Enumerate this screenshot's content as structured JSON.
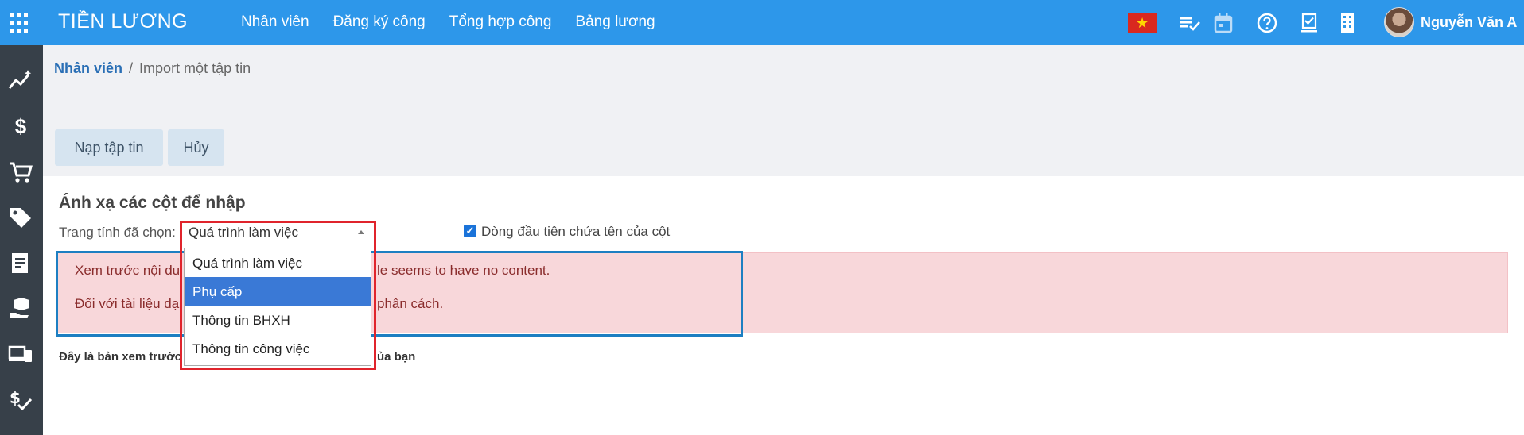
{
  "header": {
    "brand": "TIỀN LƯƠNG",
    "nav": [
      "Nhân viên",
      "Đăng ký công",
      "Tổng hợp công",
      "Bảng lương"
    ],
    "user_name": "Nguyễn Văn A",
    "icons": [
      "apps-grid-icon",
      "vietnam-flag-icon",
      "checklist-icon",
      "calendar-icon",
      "help-icon",
      "approval-icon",
      "building-icon",
      "user-avatar"
    ]
  },
  "sidebar": {
    "icons": [
      "chart-trend-icon",
      "dollar-icon",
      "cart-icon",
      "tag-icon",
      "receipt-icon",
      "box-hand-icon",
      "devices-icon",
      "money-check-icon"
    ]
  },
  "breadcrumb": {
    "link": "Nhân viên",
    "separator": "/",
    "current": "Import một tập tin"
  },
  "toolbar": {
    "load_label": "Nạp tập tin",
    "cancel_label": "Hủy"
  },
  "mapping": {
    "title": "Ánh xạ các cột để nhập",
    "sheet_label": "Trang tính đã chọn:",
    "selected_sheet": "Quá trình làm việc",
    "options": [
      "Quá trình làm việc",
      "Phụ cấp",
      "Thông tin BHXH",
      "Thông tin công việc"
    ],
    "highlighted_option": "Phụ cấp",
    "header_row_checked": true,
    "header_row_label": "Dòng đầu tiên chứa tên của cột"
  },
  "alert": {
    "line1_start": "Xem trước nội du",
    "line1_end": "le seems to have no content.",
    "line2_start": "Đối với tài liệu dạ",
    "line2_end": "phân cách."
  },
  "preview": {
    "note_start": "Đây là bản xem trước",
    "note_end": "ủa bạn"
  },
  "colors": {
    "topbar": "#2d97ea",
    "sidebar": "#374049",
    "alert_bg": "#f8d7da",
    "highlight": "#3a79d6"
  }
}
